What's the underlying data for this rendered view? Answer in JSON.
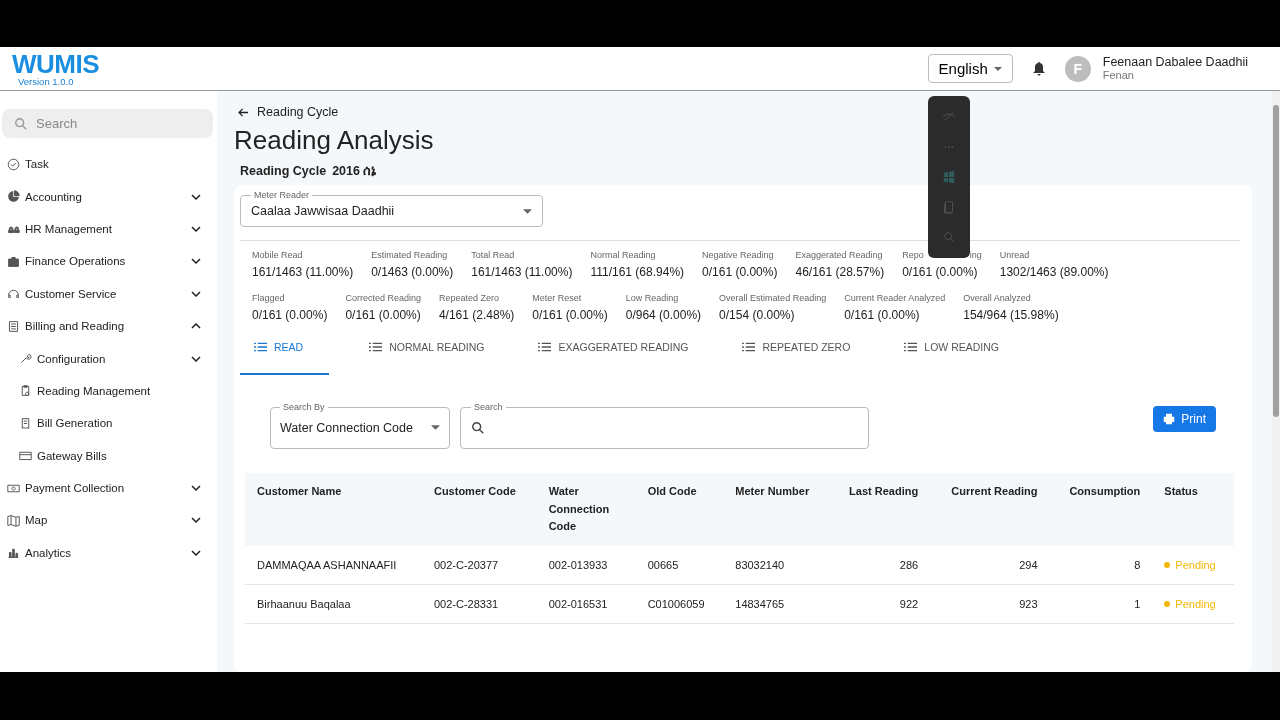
{
  "header": {
    "logo": "WUMIS",
    "version": "Version 1.0.0",
    "language": "English",
    "user": {
      "initial": "F",
      "name": "Feenaan Dabalee Daadhii",
      "username": "Fenan"
    }
  },
  "sidebar": {
    "search": {
      "placeholder": "Search"
    },
    "items": [
      {
        "label": "Task"
      },
      {
        "label": "Accounting",
        "expanded": false
      },
      {
        "label": "HR Management",
        "expanded": false
      },
      {
        "label": "Finance Operations",
        "expanded": false
      },
      {
        "label": "Customer Service",
        "expanded": false
      },
      {
        "label": "Billing and Reading",
        "expanded": true,
        "children": [
          {
            "label": "Configuration",
            "expanded": false
          },
          {
            "label": "Reading Management"
          },
          {
            "label": "Bill Generation"
          },
          {
            "label": "Gateway Bills"
          }
        ]
      },
      {
        "label": "Payment Collection",
        "expanded": false
      },
      {
        "label": "Map",
        "expanded": false
      },
      {
        "label": "Analytics",
        "expanded": false
      }
    ]
  },
  "page": {
    "back_link": "Reading Cycle",
    "title": "Reading Analysis",
    "cycle_label": "Reading Cycle",
    "cycle_value": "2016 ሰኔ",
    "meter_reader": {
      "label": "Meter Reader",
      "value": "Caalaa Jawwisaa Daadhii"
    },
    "stats": [
      [
        {
          "label": "Mobile Read",
          "value": "161/1463 (11.00%)"
        },
        {
          "label": "Estimated Reading",
          "value": "0/1463 (0.00%)"
        },
        {
          "label": "Total Read",
          "value": "161/1463 (11.00%)"
        },
        {
          "label": "Normal Reading",
          "value": "111/161 (68.94%)"
        },
        {
          "label": "Negative Reading",
          "value": "0/161 (0.00%)"
        },
        {
          "label": "Exaggerated Reading",
          "value": "46/161 (28.57%)"
        },
        {
          "label": "Repo",
          "label_end": "ing",
          "value": "0/161 (0.00%)"
        },
        {
          "label": "Unread",
          "value": "1302/1463 (89.00%)"
        }
      ],
      [
        {
          "label": "Flagged",
          "value": "0/161 (0.00%)"
        },
        {
          "label": "Corrected Reading",
          "value": "0/161 (0.00%)"
        },
        {
          "label": "Repeated Zero",
          "value": "4/161 (2.48%)"
        },
        {
          "label": "Meter Reset",
          "value": "0/161 (0.00%)"
        },
        {
          "label": "Low Reading",
          "value": "0/964 (0.00%)"
        },
        {
          "label": "Overall Estimated Reading",
          "value": "0/154 (0.00%)"
        },
        {
          "label": "Current Reader Analyzed",
          "value": "0/161 (0.00%)"
        },
        {
          "label": "Overall Analyzed",
          "value": "154/964 (15.98%)"
        }
      ]
    ],
    "tabs": [
      {
        "label": "READ",
        "selected": true
      },
      {
        "label": "NORMAL READING",
        "selected": false
      },
      {
        "label": "EXAGGERATED READING",
        "selected": false
      },
      {
        "label": "REPEATED ZERO",
        "selected": false
      },
      {
        "label": "LOW READING",
        "selected": false
      }
    ],
    "search_by": {
      "label": "Search By",
      "value": "Water Connection Code"
    },
    "search": {
      "label": "Search"
    },
    "print_button": "Print",
    "table": {
      "columns": [
        "Customer Name",
        "Customer Code",
        "Water Connection Code",
        "Old Code",
        "Meter Number",
        "Last Reading",
        "Current Reading",
        "Consumption",
        "Status"
      ],
      "rows": [
        {
          "cells": [
            "DAMMAQAA ASHANNAAFII",
            "002-C-20377",
            "002-013933",
            "00665",
            "83032140",
            "286",
            "294",
            "8"
          ],
          "status": "Pending"
        },
        {
          "cells": [
            "Birhaanuu Baqalaa",
            "002-C-28331",
            "002-016531",
            "C01006059",
            "14834765",
            "922",
            "923",
            "1"
          ],
          "status": "Pending"
        }
      ]
    }
  }
}
